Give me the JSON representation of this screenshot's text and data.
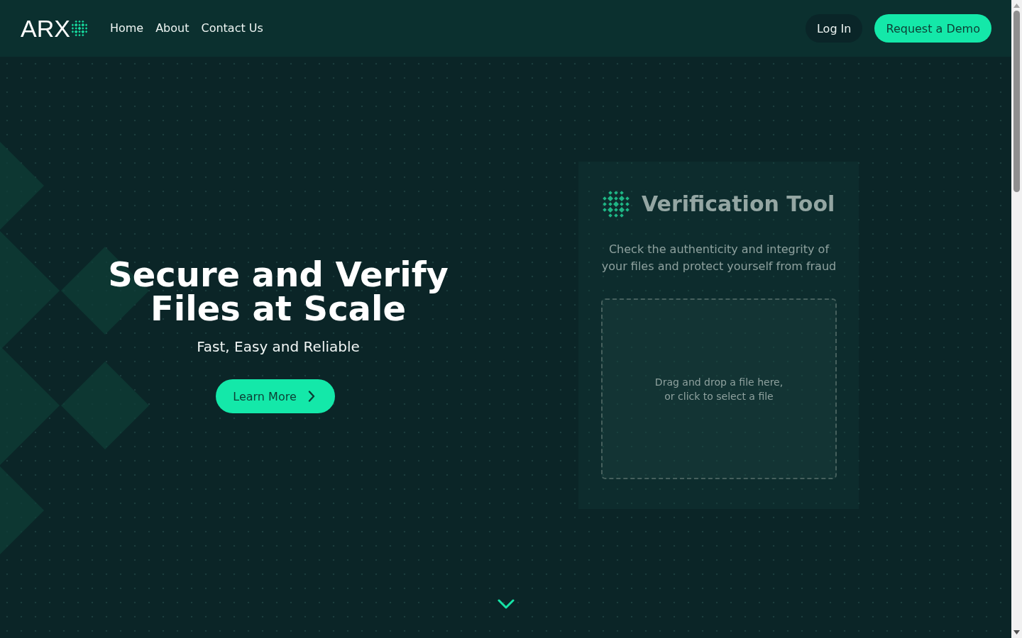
{
  "header": {
    "logo": {
      "text": "ARX"
    },
    "nav": [
      {
        "label": "Home"
      },
      {
        "label": "About"
      },
      {
        "label": "Contact Us"
      }
    ],
    "actions": [
      {
        "label": "Log In",
        "kind": "secondary"
      },
      {
        "label": "Request a Demo",
        "kind": "primary"
      }
    ]
  },
  "hero": {
    "title": "Secure and Verify Files at Scale",
    "subtitle": "Fast, Easy and Reliable",
    "button": {
      "label": "Learn More"
    }
  },
  "verification_tool": {
    "title": "Verification Tool",
    "description": "Check the authenticity and integrity of your files and protect yourself from fraud",
    "dropzone": {
      "placeholder": "Drag and drop a file here, or click to select a file"
    }
  }
}
